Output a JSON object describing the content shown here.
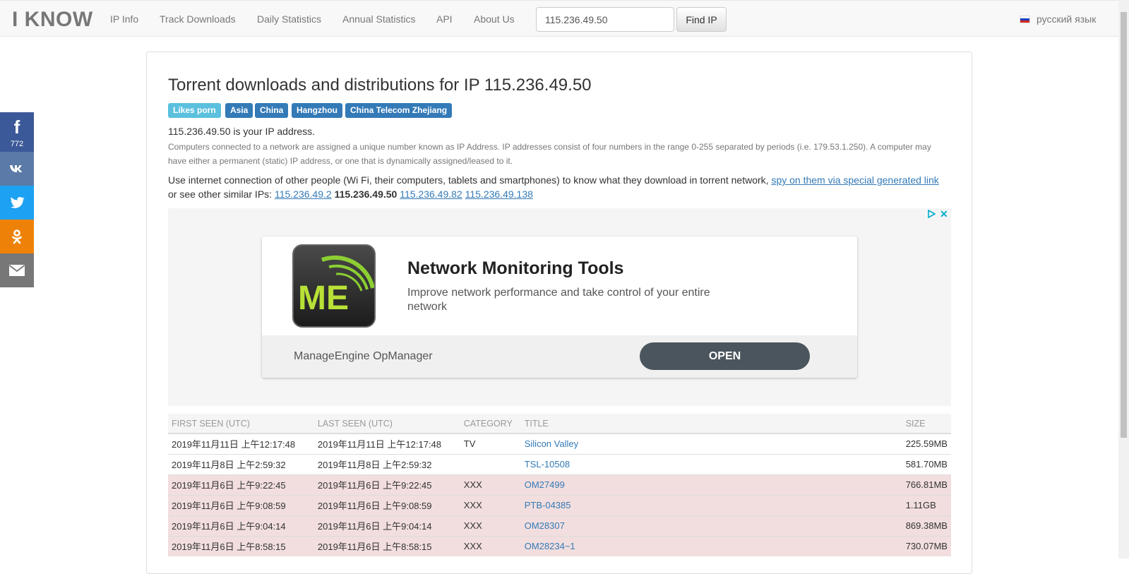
{
  "navbar": {
    "brand": "I KNOW",
    "links": [
      "IP Info",
      "Track Downloads",
      "Daily Statistics",
      "Annual Statistics",
      "API",
      "About Us"
    ],
    "search_value": "115.236.49.50",
    "find_button": "Find IP",
    "language": "русский язык"
  },
  "social": {
    "facebook_count": "772"
  },
  "header": {
    "title": "Torrent downloads and distributions for IP 115.236.49.50",
    "badges": [
      "Likes porn",
      "Asia",
      "China",
      "Hangzhou",
      "China Telecom Zhejiang"
    ]
  },
  "info": {
    "your_ip": "115.236.49.50 is your IP address.",
    "explanation": "Computers connected to a network are assigned a unique number known as IP Address. IP addresses consist of four numbers in the range 0-255 separated by periods (i.e. 179.53.1.250). A computer may have either a permanent (static) IP address, or one that is dynamically assigned/leased to it.",
    "use_text": "Use internet connection of other people (Wi Fi, their computers, tablets and smartphones) to know what they download in torrent network,",
    "spy_link": "spy on them via special generated link",
    "similar_prefix": "or see other similar IPs:",
    "similar_ips": [
      "115.236.49.2",
      "115.236.49.50",
      "115.236.49.82",
      "115.236.49.138"
    ]
  },
  "ad": {
    "headline": "Network Monitoring Tools",
    "description": "Improve network performance and take control of your entire network",
    "brand": "ManageEngine OpManager",
    "cta": "OPEN",
    "logo_text": "ME",
    "close": "✕"
  },
  "table": {
    "headers": [
      "FIRST SEEN (UTC)",
      "LAST SEEN (UTC)",
      "CATEGORY",
      "TITLE",
      "SIZE"
    ],
    "rows": [
      {
        "first": "2019年11月11日 上午12:17:48",
        "last": "2019年11月11日 上午12:17:48",
        "category": "TV",
        "title": "Silicon Valley",
        "size": "225.59MB"
      },
      {
        "first": "2019年11月8日 上午2:59:32",
        "last": "2019年11月8日 上午2:59:32",
        "category": "",
        "title": "TSL-10508",
        "size": "581.70MB"
      },
      {
        "first": "2019年11月6日 上午9:22:45",
        "last": "2019年11月6日 上午9:22:45",
        "category": "XXX",
        "title": "OM27499",
        "size": "766.81MB"
      },
      {
        "first": "2019年11月6日 上午9:08:59",
        "last": "2019年11月6日 上午9:08:59",
        "category": "XXX",
        "title": "PTB-04385",
        "size": "1.11GB"
      },
      {
        "first": "2019年11月6日 上午9:04:14",
        "last": "2019年11月6日 上午9:04:14",
        "category": "XXX",
        "title": "OM28307",
        "size": "869.38MB"
      },
      {
        "first": "2019年11月6日 上午8:58:15",
        "last": "2019年11月6日 上午8:58:15",
        "category": "XXX",
        "title": "OM28234~1",
        "size": "730.07MB"
      }
    ]
  },
  "colors": {
    "link": "#337ab7",
    "badge_info": "#5bc0de",
    "badge_primary": "#337ab7",
    "xxx_row": "#f2dede"
  }
}
